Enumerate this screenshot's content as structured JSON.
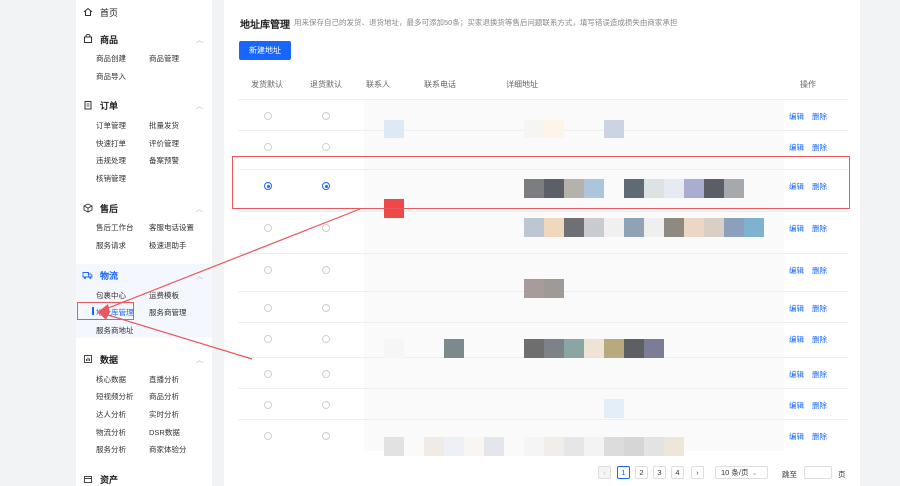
{
  "sidebar": {
    "home": "首页",
    "groups": [
      {
        "title": "商品",
        "items": [
          "商品创建",
          "商品管理",
          "商品导入"
        ]
      },
      {
        "title": "订单",
        "items": [
          "订单管理",
          "批量发货",
          "快速打单",
          "评价管理",
          "违规处理",
          "备案预警",
          "核销管理"
        ]
      },
      {
        "title": "售后",
        "items": [
          "售后工作台",
          "客服电话设置",
          "服务请求",
          "极速退助手"
        ]
      },
      {
        "title": "物流",
        "items": [
          "包裹中心",
          "运费模板",
          "地址库管理",
          "服务商管理",
          "服务商地址"
        ]
      },
      {
        "title": "数据",
        "items": [
          "核心数据",
          "直播分析",
          "短视频分析",
          "商品分析",
          "达人分析",
          "实时分析",
          "物流分析",
          "DSR数据",
          "服务分析",
          "商家体验分"
        ]
      },
      {
        "title": "资产",
        "items": []
      }
    ]
  },
  "main": {
    "title": "地址库管理",
    "tip": "用来保存自己的发货、退货地址，最多可添加50条；买家退换货等售后问题联系方式，填写错误造成损失由商家承担",
    "new_button": "新建地址",
    "columns": [
      "发货默认",
      "退货默认",
      "联系人",
      "联系电话",
      "详细地址",
      "操作"
    ],
    "edit_label": "编辑",
    "delete_label": "删除",
    "rows": [
      {
        "ship_default": false,
        "return_default": false
      },
      {
        "ship_default": false,
        "return_default": false
      },
      {
        "ship_default": true,
        "return_default": true
      },
      {
        "ship_default": false,
        "return_default": false
      },
      {
        "ship_default": false,
        "return_default": false
      },
      {
        "ship_default": false,
        "return_default": false
      },
      {
        "ship_default": false,
        "return_default": false
      },
      {
        "ship_default": false,
        "return_default": false
      },
      {
        "ship_default": false,
        "return_default": false
      },
      {
        "ship_default": false,
        "return_default": false
      }
    ]
  },
  "pagination": {
    "pages": [
      "1",
      "2",
      "3",
      "4"
    ],
    "current": "1",
    "page_size": "10 条/页",
    "jump_label": "跳至",
    "page_unit": "页"
  },
  "colors": {
    "accent": "#1966ff",
    "annotation": "#e8585d"
  }
}
